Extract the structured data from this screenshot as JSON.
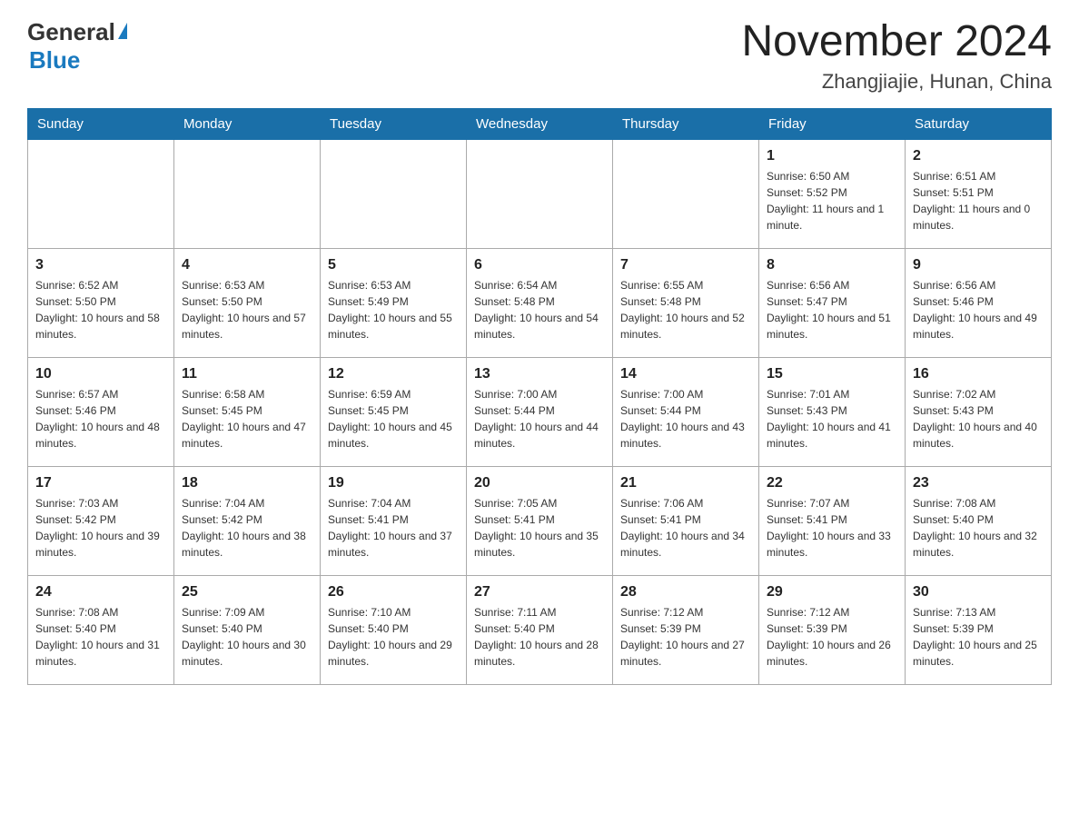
{
  "header": {
    "logo_general": "General",
    "logo_blue": "Blue",
    "month_title": "November 2024",
    "location": "Zhangjiajie, Hunan, China"
  },
  "days_of_week": [
    "Sunday",
    "Monday",
    "Tuesday",
    "Wednesday",
    "Thursday",
    "Friday",
    "Saturday"
  ],
  "weeks": [
    [
      {
        "day": "",
        "info": ""
      },
      {
        "day": "",
        "info": ""
      },
      {
        "day": "",
        "info": ""
      },
      {
        "day": "",
        "info": ""
      },
      {
        "day": "",
        "info": ""
      },
      {
        "day": "1",
        "info": "Sunrise: 6:50 AM\nSunset: 5:52 PM\nDaylight: 11 hours and 1 minute."
      },
      {
        "day": "2",
        "info": "Sunrise: 6:51 AM\nSunset: 5:51 PM\nDaylight: 11 hours and 0 minutes."
      }
    ],
    [
      {
        "day": "3",
        "info": "Sunrise: 6:52 AM\nSunset: 5:50 PM\nDaylight: 10 hours and 58 minutes."
      },
      {
        "day": "4",
        "info": "Sunrise: 6:53 AM\nSunset: 5:50 PM\nDaylight: 10 hours and 57 minutes."
      },
      {
        "day": "5",
        "info": "Sunrise: 6:53 AM\nSunset: 5:49 PM\nDaylight: 10 hours and 55 minutes."
      },
      {
        "day": "6",
        "info": "Sunrise: 6:54 AM\nSunset: 5:48 PM\nDaylight: 10 hours and 54 minutes."
      },
      {
        "day": "7",
        "info": "Sunrise: 6:55 AM\nSunset: 5:48 PM\nDaylight: 10 hours and 52 minutes."
      },
      {
        "day": "8",
        "info": "Sunrise: 6:56 AM\nSunset: 5:47 PM\nDaylight: 10 hours and 51 minutes."
      },
      {
        "day": "9",
        "info": "Sunrise: 6:56 AM\nSunset: 5:46 PM\nDaylight: 10 hours and 49 minutes."
      }
    ],
    [
      {
        "day": "10",
        "info": "Sunrise: 6:57 AM\nSunset: 5:46 PM\nDaylight: 10 hours and 48 minutes."
      },
      {
        "day": "11",
        "info": "Sunrise: 6:58 AM\nSunset: 5:45 PM\nDaylight: 10 hours and 47 minutes."
      },
      {
        "day": "12",
        "info": "Sunrise: 6:59 AM\nSunset: 5:45 PM\nDaylight: 10 hours and 45 minutes."
      },
      {
        "day": "13",
        "info": "Sunrise: 7:00 AM\nSunset: 5:44 PM\nDaylight: 10 hours and 44 minutes."
      },
      {
        "day": "14",
        "info": "Sunrise: 7:00 AM\nSunset: 5:44 PM\nDaylight: 10 hours and 43 minutes."
      },
      {
        "day": "15",
        "info": "Sunrise: 7:01 AM\nSunset: 5:43 PM\nDaylight: 10 hours and 41 minutes."
      },
      {
        "day": "16",
        "info": "Sunrise: 7:02 AM\nSunset: 5:43 PM\nDaylight: 10 hours and 40 minutes."
      }
    ],
    [
      {
        "day": "17",
        "info": "Sunrise: 7:03 AM\nSunset: 5:42 PM\nDaylight: 10 hours and 39 minutes."
      },
      {
        "day": "18",
        "info": "Sunrise: 7:04 AM\nSunset: 5:42 PM\nDaylight: 10 hours and 38 minutes."
      },
      {
        "day": "19",
        "info": "Sunrise: 7:04 AM\nSunset: 5:41 PM\nDaylight: 10 hours and 37 minutes."
      },
      {
        "day": "20",
        "info": "Sunrise: 7:05 AM\nSunset: 5:41 PM\nDaylight: 10 hours and 35 minutes."
      },
      {
        "day": "21",
        "info": "Sunrise: 7:06 AM\nSunset: 5:41 PM\nDaylight: 10 hours and 34 minutes."
      },
      {
        "day": "22",
        "info": "Sunrise: 7:07 AM\nSunset: 5:41 PM\nDaylight: 10 hours and 33 minutes."
      },
      {
        "day": "23",
        "info": "Sunrise: 7:08 AM\nSunset: 5:40 PM\nDaylight: 10 hours and 32 minutes."
      }
    ],
    [
      {
        "day": "24",
        "info": "Sunrise: 7:08 AM\nSunset: 5:40 PM\nDaylight: 10 hours and 31 minutes."
      },
      {
        "day": "25",
        "info": "Sunrise: 7:09 AM\nSunset: 5:40 PM\nDaylight: 10 hours and 30 minutes."
      },
      {
        "day": "26",
        "info": "Sunrise: 7:10 AM\nSunset: 5:40 PM\nDaylight: 10 hours and 29 minutes."
      },
      {
        "day": "27",
        "info": "Sunrise: 7:11 AM\nSunset: 5:40 PM\nDaylight: 10 hours and 28 minutes."
      },
      {
        "day": "28",
        "info": "Sunrise: 7:12 AM\nSunset: 5:39 PM\nDaylight: 10 hours and 27 minutes."
      },
      {
        "day": "29",
        "info": "Sunrise: 7:12 AM\nSunset: 5:39 PM\nDaylight: 10 hours and 26 minutes."
      },
      {
        "day": "30",
        "info": "Sunrise: 7:13 AM\nSunset: 5:39 PM\nDaylight: 10 hours and 25 minutes."
      }
    ]
  ]
}
